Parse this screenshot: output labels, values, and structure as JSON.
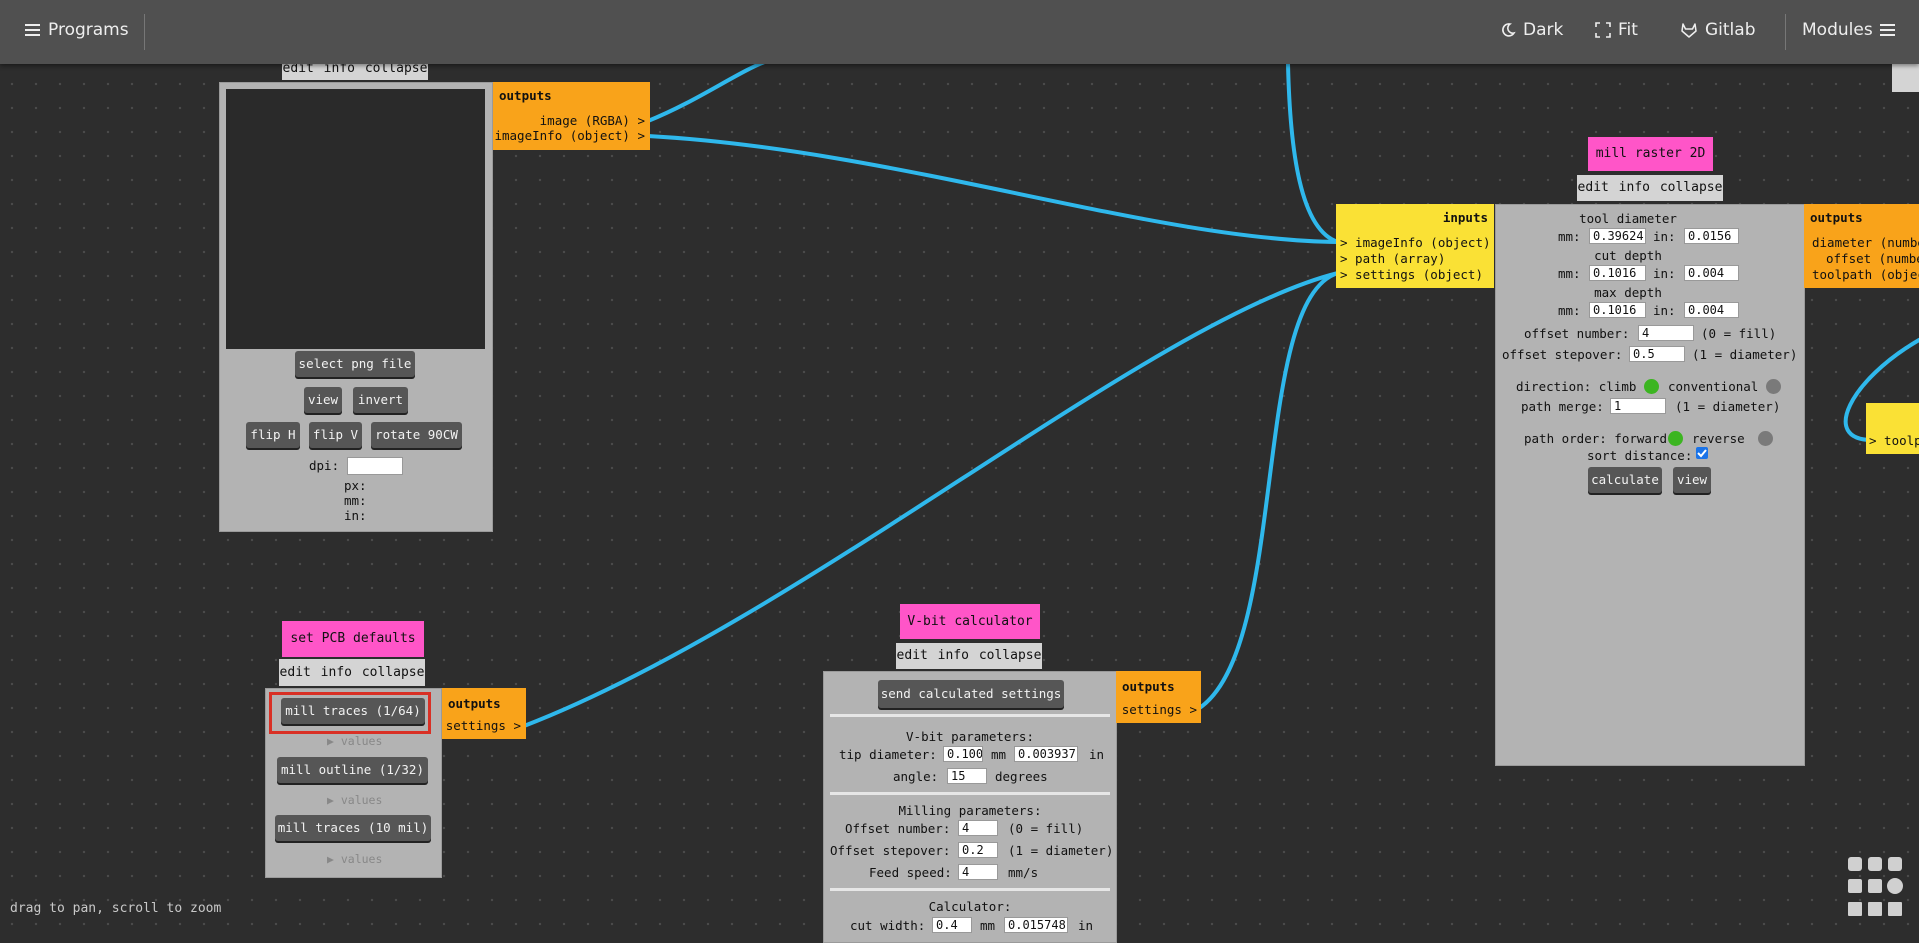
{
  "topbar": {
    "programs_label": "Programs",
    "dark_label": "Dark",
    "fit_label": "Fit",
    "gitlab_label": "Gitlab",
    "modules_label": "Modules"
  },
  "hint": "drag to pan, scroll to zoom",
  "png_module": {
    "menu": "edit info collapse",
    "select_btn": "select png file",
    "view_btn": "view",
    "invert_btn": "invert",
    "fliph_btn": "flip H",
    "flipv_btn": "flip V",
    "rotate_btn": "rotate 90CW",
    "dpi_label": "dpi:",
    "dpi_value": "",
    "px_label": "px:",
    "mm_label": "mm:",
    "in_label": "in:",
    "outputs_head": "outputs",
    "out_image": "image (RGBA) >",
    "out_imageinfo": "imageInfo (object) >"
  },
  "mill_raster": {
    "title": "mill raster 2D",
    "menu": "edit info collapse",
    "inputs_head": "inputs",
    "in_imageinfo": "> imageInfo (object)",
    "in_path": "> path (array)",
    "in_settings": "> settings (object)",
    "tool_diameter_label": "tool diameter",
    "tool_mm": "0.39624",
    "tool_in": "0.0156",
    "cut_depth_label": "cut depth",
    "cut_mm": "0.1016",
    "cut_in": "0.004",
    "max_depth_label": "max depth",
    "max_mm": "0.1016",
    "max_in": "0.004",
    "mm_label": "mm:",
    "in_label": "in:",
    "offset_number_label": "offset number:",
    "offset_number": "4",
    "offset_number_hint": "(0 = fill)",
    "offset_stepover_label": "offset stepover:",
    "offset_stepover": "0.5",
    "offset_stepover_hint": "(1 = diameter)",
    "direction_label": "direction: climb",
    "conventional_label": "conventional",
    "path_merge_label": "path merge:",
    "path_merge": "1",
    "path_merge_hint": "(1 = diameter)",
    "path_order_label": "path order: forward",
    "reverse_label": "reverse",
    "sort_distance_label": "sort distance:",
    "calculate_btn": "calculate",
    "view_btn": "view",
    "outputs_head": "outputs",
    "out_diameter": "diameter (number)",
    "out_offset": "offset (number)",
    "out_toolpath": "toolpath (object)",
    "right_input": "> toolp"
  },
  "pcb_defaults": {
    "title": "set PCB defaults",
    "menu": "edit info collapse",
    "btn1": "mill traces (1/64)",
    "btn2": "mill outline (1/32)",
    "btn3": "mill traces (10 mil)",
    "values": "▶ values",
    "outputs_head": "outputs",
    "out_settings": "settings >"
  },
  "vbit": {
    "title": "V-bit calculator",
    "menu": "edit info collapse",
    "send_btn": "send calculated settings",
    "vbit_params": "V-bit parameters:",
    "tip_label": "tip diameter:",
    "tip_mm": "0.100",
    "tip_in": "0.003937",
    "mm": "mm",
    "in": "in",
    "angle_label": "angle:",
    "angle": "15",
    "degrees": "degrees",
    "milling_params": "Milling parameters:",
    "offset_number_label": "Offset number:",
    "offset_number": "4",
    "offset_number_hint": "(0 = fill)",
    "offset_stepover_label": "Offset stepover:",
    "offset_stepover": "0.2",
    "offset_stepover_hint": "(1 = diameter)",
    "feed_label": "Feed speed:",
    "feed": "4",
    "feed_unit": "mm/s",
    "calculator_label": "Calculator:",
    "cut_width_label": "cut width:",
    "cut_width_mm": "0.4",
    "cut_width_in": "0.015748",
    "outputs_head": "outputs",
    "out_settings": "settings >"
  },
  "colors": {
    "background": "#2d2d2d",
    "wire": "#2fb8ec",
    "title": "#ff55c8",
    "outputs": "#f9a31a",
    "inputs": "#fae135",
    "module": "#b3b3b3",
    "radio_on": "#3cb521"
  }
}
